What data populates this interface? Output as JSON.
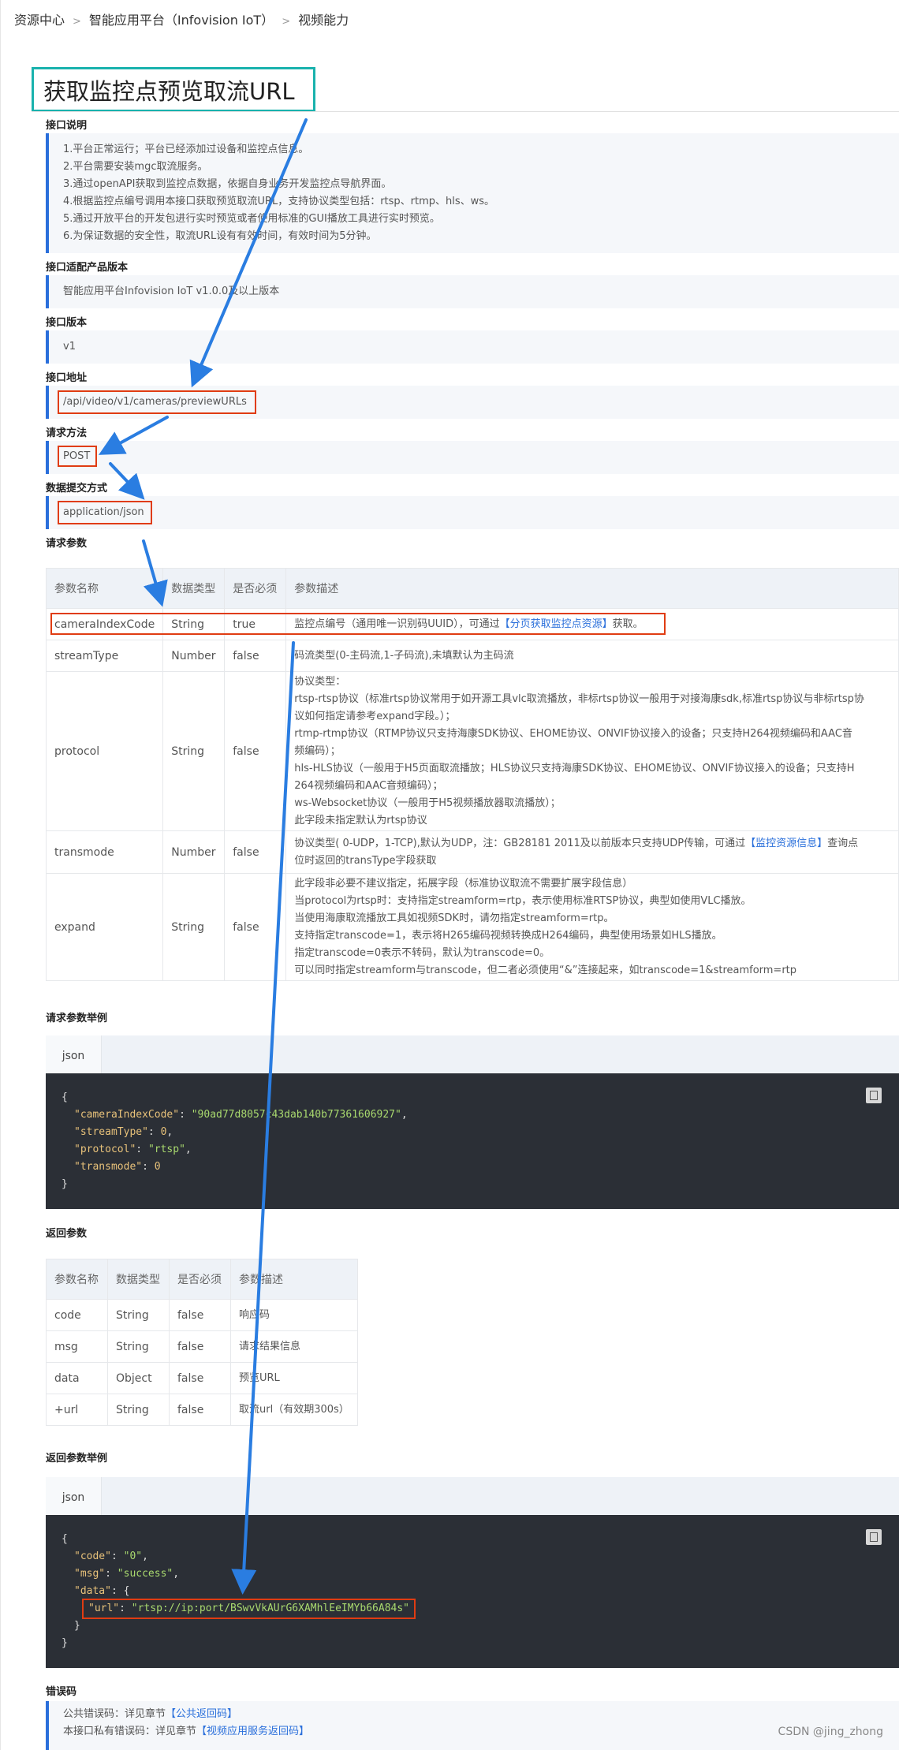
{
  "breadcrumb": [
    "资源中心",
    "智能应用平台（Infovision IoT）",
    "视频能力"
  ],
  "title": "获取监控点预览取流URL",
  "sections": {
    "intro": "接口说明",
    "product": "接口适配产品版本",
    "version": "接口版本",
    "address": "接口地址",
    "method": "请求方法",
    "content_type": "数据提交方式",
    "req_params": "请求参数",
    "req_example": "请求参数举例",
    "resp_params": "返回参数",
    "resp_example": "返回参数举例",
    "error_codes": "错误码"
  },
  "intro_lines": [
    "1.平台正常运行；平台已经添加过设备和监控点信息。",
    "2.平台需要安装mgc取流服务。",
    "3.通过openAPI获取到监控点数据，依据自身业务开发监控点导航界面。",
    "4.根据监控点编号调用本接口获取预览取流URL，支持协议类型包括：rtsp、rtmp、hls、ws。",
    "5.通过开放平台的开发包进行实时预览或者使用标准的GUI播放工具进行实时预览。",
    "6.为保证数据的安全性，取流URL设有有效时间，有效时间为5分钟。"
  ],
  "product_version": "智能应用平台Infovision IoT v1.0.0及以上版本",
  "api_version": "v1",
  "api_address": "/api/video/v1/cameras/previewURLs",
  "method": "POST",
  "content_type": "application/json",
  "req_table": {
    "headers": [
      "参数名称",
      "数据类型",
      "是否必须",
      "参数描述"
    ],
    "rows": [
      {
        "name": "cameraIndexCode",
        "type": "String",
        "required": "true",
        "desc": [
          "监控点编号（通用唯一识别码UUID），可通过",
          "【分页获取监控点资源】",
          "获取。"
        ]
      },
      {
        "name": "streamType",
        "type": "Number",
        "required": "false",
        "desc": [
          "码流类型(0-主码流,1-子码流),未填默认为主码流"
        ]
      },
      {
        "name": "protocol",
        "type": "String",
        "required": "false",
        "desc": [
          "协议类型：",
          "rtsp-rtsp协议（标准rtsp协议常用于如开源工具vlc取流播放，非标rtsp协议一般用于对接海康sdk,标准rtsp协议与非标rtsp协",
          "议如何指定请参考expand字段。）；",
          "rtmp-rtmp协议（RTMP协议只支持海康SDK协议、EHOME协议、ONVIF协议接入的设备；只支持H264视频编码和AAC音",
          "频编码）；",
          "hls-HLS协议（一般用于H5页面取流播放；HLS协议只支持海康SDK协议、EHOME协议、ONVIF协议接入的设备；只支持H",
          "264视频编码和AAC音频编码）；",
          "ws-Websocket协议（一般用于H5视频播放器取流播放）；",
          "此字段未指定默认为rtsp协议"
        ]
      },
      {
        "name": "transmode",
        "type": "Number",
        "required": "false",
        "desc": [
          "协议类型( 0-UDP，1-TCP),默认为UDP，注：GB28181 2011及以前版本只支持UDP传输，可通过",
          "【监控资源信息】",
          "查询点",
          "位时返回的transType字段获取"
        ]
      },
      {
        "name": "expand",
        "type": "String",
        "required": "false",
        "desc": [
          "此字段非必要不建议指定，拓展字段（标准协议取流不需要扩展字段信息）",
          "当protocol为rtsp时：支持指定streamform=rtp，表示使用标准RTSP协议，典型如使用VLC播放。",
          "当使用海康取流播放工具如视频SDK时，请勿指定streamform=rtp。",
          "支持指定transcode=1，表示将H265编码视频转换成H264编码，典型使用场景如HLS播放。",
          "指定transcode=0表示不转码，默认为transcode=0。",
          "可以同时指定streamform与transcode，但二者必须使用“&”连接起来，如transcode=1&streamform=rtp"
        ]
      }
    ]
  },
  "tab_label": "json",
  "req_code": {
    "open": "{",
    "close": "}",
    "lines": [
      {
        "key": "\"cameraIndexCode\"",
        "value": "\"90ad77d8057c43dab140b77361606927\"",
        "sep": ","
      },
      {
        "key": "\"streamType\"",
        "value": "0",
        "sep": ","
      },
      {
        "key": "\"protocol\"",
        "value": "\"rtsp\"",
        "sep": ","
      },
      {
        "key": "\"transmode\"",
        "value": "0",
        "sep": ""
      }
    ]
  },
  "resp_table": {
    "headers": [
      "参数名称",
      "数据类型",
      "是否必须",
      "参数描述"
    ],
    "rows": [
      {
        "name": "code",
        "type": "String",
        "required": "false",
        "desc": "响应码"
      },
      {
        "name": "msg",
        "type": "String",
        "required": "false",
        "desc": "请求结果信息"
      },
      {
        "name": "data",
        "type": "Object",
        "required": "false",
        "desc": "预览URL"
      },
      {
        "name": "+url",
        "type": "String",
        "required": "false",
        "desc": "取流url（有效期300s）"
      }
    ]
  },
  "resp_code": {
    "open": "{",
    "code_key": "\"code\"",
    "code_val": "\"0\"",
    "msg_key": "\"msg\"",
    "msg_val": "\"success\"",
    "data_key": "\"data\"",
    "data_open": "{",
    "url_key": "\"url\"",
    "url_val": "\"rtsp://ip:port/BSwvVkAUrG6XAMhlEeIMYb66A84s\"",
    "data_close": "}",
    "close": "}"
  },
  "error_lines": [
    {
      "prefix": "公共错误码：详见章节",
      "link": "【公共返回码】"
    },
    {
      "prefix": "本接口私有错误码：详见章节",
      "link": "【视频应用服务返回码】"
    }
  ],
  "watermark": "CSDN @jing_zhong",
  "colors": {
    "accent_teal": "#19b2ad",
    "highlight_red": "#e03c12",
    "arrow_blue": "#2a7de1",
    "link": "#2a6fdb",
    "code_bg": "#2b2f36"
  }
}
